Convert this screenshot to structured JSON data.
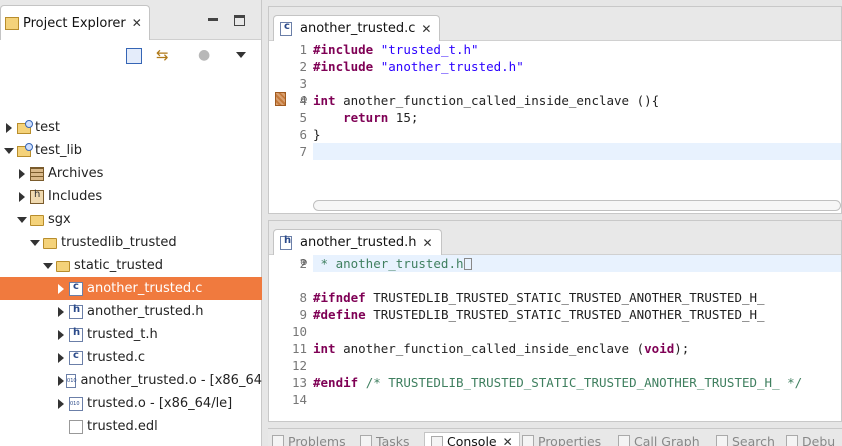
{
  "explorer": {
    "tab_title": "Project Explorer",
    "tree": [
      {
        "label": "test",
        "depth": 0,
        "expanded": false,
        "icon": "project-folder-icon"
      },
      {
        "label": "test_lib",
        "depth": 0,
        "expanded": true,
        "icon": "project-folder-icon"
      },
      {
        "label": "Archives",
        "depth": 1,
        "expanded": false,
        "icon": "archives-icon"
      },
      {
        "label": "Includes",
        "depth": 1,
        "expanded": false,
        "icon": "includes-icon"
      },
      {
        "label": "sgx",
        "depth": 1,
        "expanded": true,
        "icon": "folder-icon"
      },
      {
        "label": "trustedlib_trusted",
        "depth": 2,
        "expanded": true,
        "icon": "folder-icon"
      },
      {
        "label": "static_trusted",
        "depth": 3,
        "expanded": true,
        "icon": "folder-icon"
      },
      {
        "label": "another_trusted.c",
        "depth": 4,
        "expanded": false,
        "icon": "c-file-icon",
        "selected": true
      },
      {
        "label": "another_trusted.h",
        "depth": 4,
        "expanded": false,
        "icon": "h-file-icon"
      },
      {
        "label": "trusted_t.h",
        "depth": 4,
        "expanded": false,
        "icon": "h-file-icon"
      },
      {
        "label": "trusted.c",
        "depth": 4,
        "expanded": false,
        "icon": "c-file-icon"
      },
      {
        "label": "another_trusted.o - [x86_64",
        "depth": 4,
        "expanded": false,
        "icon": "object-file-icon"
      },
      {
        "label": "trusted.o - [x86_64/le]",
        "depth": 4,
        "expanded": false,
        "icon": "object-file-icon"
      },
      {
        "label": "trusted.edl",
        "depth": 4,
        "noarrow": true,
        "icon": "edl-file-icon"
      }
    ]
  },
  "editor1": {
    "tab_title": "another_trusted.c",
    "lines": [
      {
        "n": "1",
        "code": "#include \"trusted_t.h\""
      },
      {
        "n": "2",
        "code": "#include \"another_trusted.h\""
      },
      {
        "n": "3",
        "code": ""
      },
      {
        "n": "4",
        "code": "int another_function_called_inside_enclave (){"
      },
      {
        "n": "5",
        "code": "    return 15;"
      },
      {
        "n": "6",
        "code": "}"
      },
      {
        "n": "7",
        "code": ""
      }
    ]
  },
  "editor2": {
    "tab_title": "another_trusted.h",
    "lines": [
      {
        "n": "2",
        "code": " * another_trusted.h"
      },
      {
        "n": "",
        "code": ""
      },
      {
        "n": "8",
        "code": "#ifndef TRUSTEDLIB_TRUSTED_STATIC_TRUSTED_ANOTHER_TRUSTED_H_"
      },
      {
        "n": "9",
        "code": "#define TRUSTEDLIB_TRUSTED_STATIC_TRUSTED_ANOTHER_TRUSTED_H_"
      },
      {
        "n": "10",
        "code": ""
      },
      {
        "n": "11",
        "code": "int another_function_called_inside_enclave (void);"
      },
      {
        "n": "12",
        "code": ""
      },
      {
        "n": "13",
        "code": "#endif /* TRUSTEDLIB_TRUSTED_STATIC_TRUSTED_ANOTHER_TRUSTED_H_ */"
      },
      {
        "n": "14",
        "code": ""
      }
    ]
  },
  "bottom_tabs": [
    {
      "label": "Problems",
      "active": false
    },
    {
      "label": "Tasks",
      "active": false
    },
    {
      "label": "Console",
      "active": true
    },
    {
      "label": "Properties",
      "active": false
    },
    {
      "label": "Call Graph",
      "active": false
    },
    {
      "label": "Search",
      "active": false
    },
    {
      "label": "Debu",
      "active": false
    }
  ],
  "colors": {
    "selection": "#f07a3e",
    "keyword": "#7f0055",
    "string": "#2a00ff",
    "comment": "#3f7f5f",
    "current_line": "#e8f2fe"
  }
}
